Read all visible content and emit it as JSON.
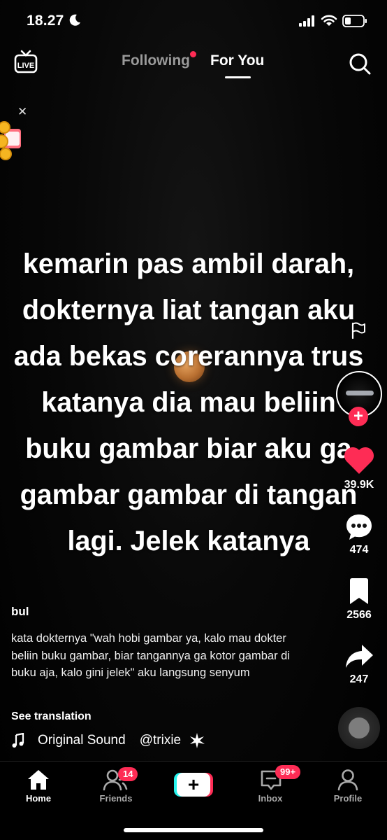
{
  "status_bar": {
    "time": "18.27"
  },
  "top_nav": {
    "tabs": [
      {
        "label": "Following",
        "active": false,
        "has_dot": true
      },
      {
        "label": "For You",
        "active": true
      }
    ]
  },
  "video": {
    "overlay_text": "kemarin pas ambil darah, dokternya liat tangan aku ada bekas corerannya trus katanya dia mau beliin buku gambar biar aku ga gambar gambar di tangan lagi. Jelek katanya",
    "overlay_lines": [
      "kemarin pas ambil darah,",
      "dokternya liat tangan aku",
      "ada bekas corerannya trus",
      "katanya dia mau beliin",
      "buku gambar biar aku ga",
      "gambar gambar di tangan",
      "lagi. Jelek katanya"
    ]
  },
  "actions": {
    "likes": "39.9K",
    "comments": "474",
    "bookmarks": "2566",
    "shares": "247"
  },
  "post": {
    "username": "bul",
    "description": "kata dokternya \"wah hobi gambar ya, kalo mau dokter beliin buku gambar, biar tangannya ga kotor gambar di buku aja, kalo gini jelek\" aku langsung senyum",
    "see_translation": "See translation",
    "sound_name": "Original Sound",
    "sound_author": "@trixie"
  },
  "bottom_nav": {
    "home": "Home",
    "friends": "Friends",
    "friends_badge": "14",
    "inbox": "Inbox",
    "inbox_badge": "99+",
    "profile": "Profile"
  },
  "colors": {
    "accent": "#fe2c55",
    "cyan": "#25f4ee",
    "background": "#000000"
  },
  "icons": [
    "live-icon",
    "search-icon",
    "flag-icon",
    "heart-icon",
    "comment-icon",
    "bookmark-icon",
    "share-icon",
    "music-note-icon",
    "home-icon",
    "friends-icon",
    "inbox-icon",
    "profile-icon"
  ]
}
